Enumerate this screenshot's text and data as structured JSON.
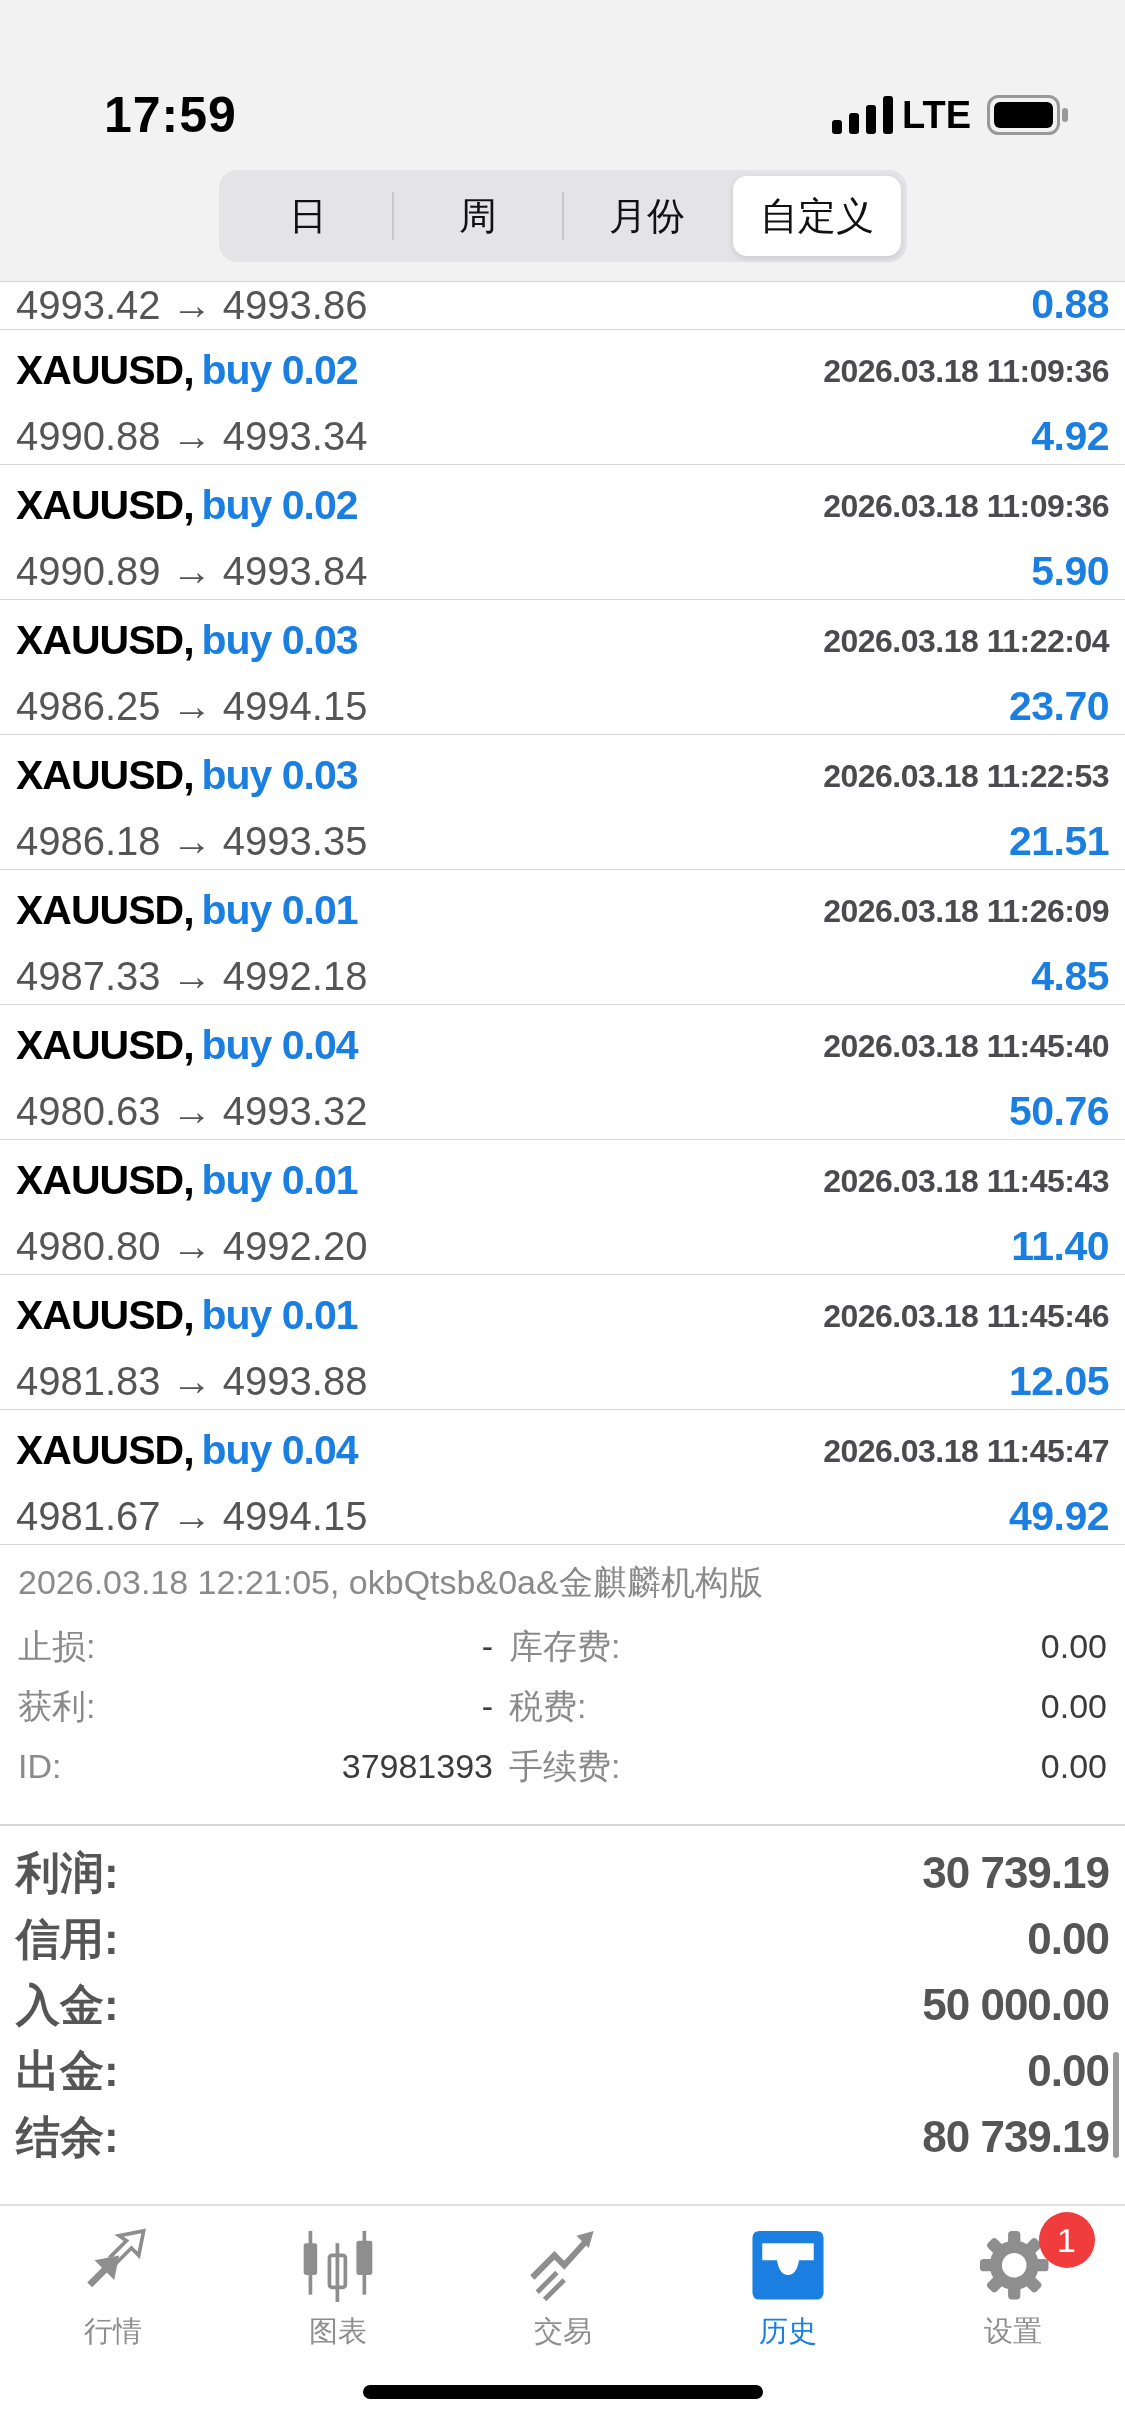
{
  "status_bar": {
    "time": "17:59",
    "network": "LTE"
  },
  "period_tabs": [
    {
      "label": "日",
      "selected": false
    },
    {
      "label": "周",
      "selected": false
    },
    {
      "label": "月份",
      "selected": false
    },
    {
      "label": "自定义",
      "selected": true
    }
  ],
  "partial_row": {
    "prices": "4993.42 → 4993.86",
    "profit": "0.88"
  },
  "trades": [
    {
      "symbol": "XAUUSD,",
      "order": "buy 0.02",
      "time": "2026.03.18 11:09:36",
      "prices": "4990.88 → 4993.34",
      "profit": "4.92"
    },
    {
      "symbol": "XAUUSD,",
      "order": "buy 0.02",
      "time": "2026.03.18 11:09:36",
      "prices": "4990.89 → 4993.84",
      "profit": "5.90"
    },
    {
      "symbol": "XAUUSD,",
      "order": "buy 0.03",
      "time": "2026.03.18 11:22:04",
      "prices": "4986.25 → 4994.15",
      "profit": "23.70"
    },
    {
      "symbol": "XAUUSD,",
      "order": "buy 0.03",
      "time": "2026.03.18 11:22:53",
      "prices": "4986.18 → 4993.35",
      "profit": "21.51"
    },
    {
      "symbol": "XAUUSD,",
      "order": "buy 0.01",
      "time": "2026.03.18 11:26:09",
      "prices": "4987.33 → 4992.18",
      "profit": "4.85"
    },
    {
      "symbol": "XAUUSD,",
      "order": "buy 0.04",
      "time": "2026.03.18 11:45:40",
      "prices": "4980.63 → 4993.32",
      "profit": "50.76"
    },
    {
      "symbol": "XAUUSD,",
      "order": "buy 0.01",
      "time": "2026.03.18 11:45:43",
      "prices": "4980.80 → 4992.20",
      "profit": "11.40"
    },
    {
      "symbol": "XAUUSD,",
      "order": "buy 0.01",
      "time": "2026.03.18 11:45:46",
      "prices": "4981.83 → 4993.88",
      "profit": "12.05"
    },
    {
      "symbol": "XAUUSD,",
      "order": "buy 0.04",
      "time": "2026.03.18 11:45:47",
      "prices": "4981.67 → 4994.15",
      "profit": "49.92"
    }
  ],
  "details": {
    "note": "2026.03.18 12:21:05, okbQtsb&0a&金麒麟机构版",
    "fields": [
      {
        "label": "止损:",
        "value": "-",
        "label2": "库存费:",
        "value2": "0.00"
      },
      {
        "label": "获利:",
        "value": "-",
        "label2": "税费:",
        "value2": "0.00"
      },
      {
        "label": "ID:",
        "value": "37981393",
        "label2": "手续费:",
        "value2": "0.00"
      }
    ]
  },
  "summary": [
    {
      "label": "利润:",
      "value": "30 739.19"
    },
    {
      "label": "信用:",
      "value": "0.00"
    },
    {
      "label": "入金:",
      "value": "50 000.00"
    },
    {
      "label": "出金:",
      "value": "0.00"
    },
    {
      "label": "结余:",
      "value": "80 739.19"
    }
  ],
  "tab_bar": [
    {
      "kind": "quotes",
      "label": "行情",
      "selected": false
    },
    {
      "kind": "chart",
      "label": "图表",
      "selected": false
    },
    {
      "kind": "trade",
      "label": "交易",
      "selected": false
    },
    {
      "kind": "history",
      "label": "历史",
      "selected": true
    },
    {
      "kind": "settings",
      "label": "设置",
      "selected": false,
      "badge": "1"
    }
  ]
}
